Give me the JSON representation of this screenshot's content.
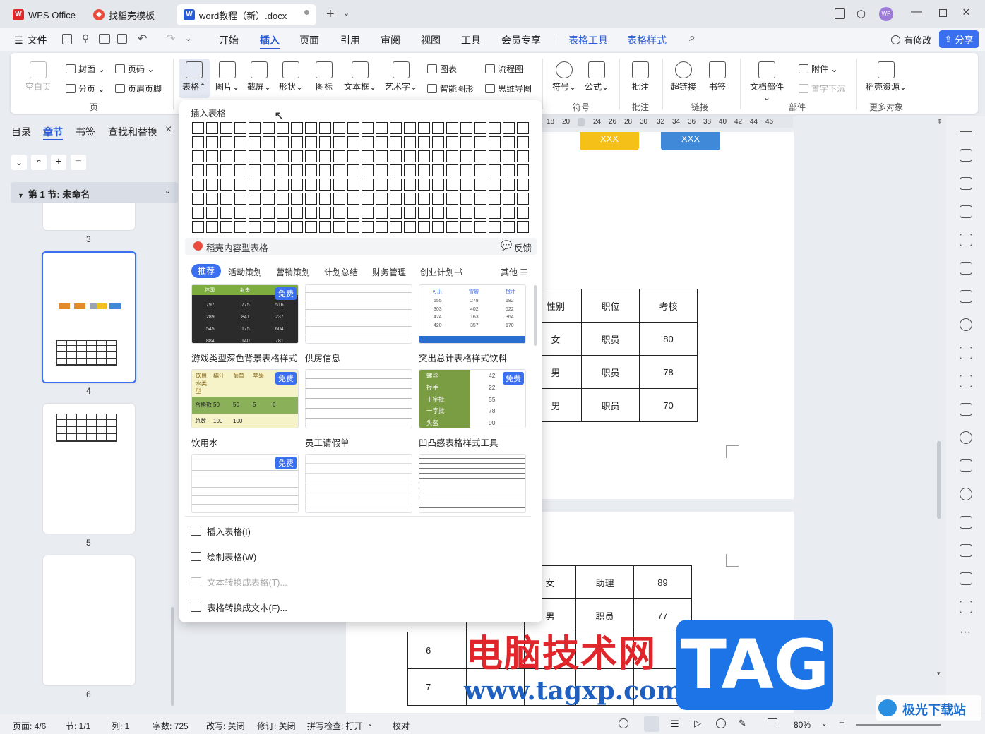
{
  "window": {
    "tabs": [
      {
        "label": "WPS Office"
      },
      {
        "label": "找稻壳模板"
      },
      {
        "label": "word教程（新）.docx"
      }
    ]
  },
  "menubar": {
    "file": "文件",
    "items": [
      "开始",
      "插入",
      "页面",
      "引用",
      "审阅",
      "视图",
      "工具",
      "会员专享",
      "表格工具",
      "表格样式"
    ],
    "has_changes": "有修改",
    "share": "分享"
  },
  "ribbon": {
    "blank_page": "空白页",
    "cover": "封面",
    "page_number": "页码",
    "section_break": "分页",
    "header_footer": "页眉页脚",
    "group_page": "页",
    "table": "表格",
    "picture": "图片",
    "screenshot": "截屏",
    "shape": "形状",
    "icon": "图标",
    "textbox": "文本框",
    "wordart": "艺术字",
    "chart": "图表",
    "smart_graphic": "智能图形",
    "flowchart": "流程图",
    "mindmap": "思维导图",
    "symbol": "符号",
    "formula": "公式",
    "group_symbol": "符号",
    "comment": "批注",
    "group_comment": "批注",
    "hyperlink": "超链接",
    "bookmark": "书签",
    "group_link": "链接",
    "attachment": "附件",
    "doc_parts": "文档部件",
    "drop_cap": "首字下沉",
    "group_parts": "部件",
    "docer_resources": "稻壳资源",
    "group_more": "更多对象"
  },
  "leftpanel": {
    "tabs": [
      "目录",
      "章节",
      "书签",
      "查找和替换"
    ],
    "section_title": "第 1 节: 未命名",
    "page_numbers": [
      "3",
      "4",
      "5",
      "6"
    ]
  },
  "ruler": {
    "ticks": [
      "18",
      "20",
      "24",
      "26",
      "28",
      "30",
      "32",
      "34",
      "36",
      "38",
      "40",
      "42",
      "44",
      "46"
    ]
  },
  "document": {
    "shape_labels": [
      "XXX",
      "XXX"
    ],
    "table1": [
      [
        "性别",
        "职位",
        "考核"
      ],
      [
        "女",
        "职员",
        "80"
      ],
      [
        "男",
        "职员",
        "78"
      ],
      [
        "男",
        "职员",
        "70"
      ]
    ],
    "table2": [
      [
        "女",
        "助理",
        "89"
      ],
      [
        "男",
        "职员",
        "77"
      ]
    ],
    "table2_row_ids": [
      "6",
      "7"
    ]
  },
  "dropdown": {
    "title": "插入表格",
    "docer_tables": "稻壳内容型表格",
    "feedback": "反馈",
    "categories": [
      "推荐",
      "活动策划",
      "营销策划",
      "计划总结",
      "财务管理",
      "创业计划书"
    ],
    "other": "其他",
    "free_badge": "免费",
    "cards": [
      {
        "label": "游戏类型深色背景表格样式",
        "free": true
      },
      {
        "label": "供房信息",
        "free": false
      },
      {
        "label": "突出总计表格样式饮料",
        "free": false
      },
      {
        "label": "饮用水",
        "free": true
      },
      {
        "label": "员工请假单",
        "free": false
      },
      {
        "label": "凹凸感表格样式工具",
        "free": true
      },
      {
        "label": "",
        "free": true
      },
      {
        "label": "",
        "free": false
      },
      {
        "label": "",
        "free": false
      }
    ],
    "card_texts": {
      "c1_headers": [
        "体国",
        "射击",
        "战术"
      ],
      "c1_rows": [
        [
          "797",
          "775",
          "516"
        ],
        [
          "289",
          "841",
          "237"
        ],
        [
          "545",
          "175",
          "604"
        ],
        [
          "884",
          "140",
          "781"
        ]
      ],
      "c3_headers": [
        "可乐",
        "雪碧",
        "橙汁"
      ],
      "c3_rows": [
        [
          "555",
          "278",
          "182"
        ],
        [
          "303",
          "402",
          "522"
        ],
        [
          "424",
          "163",
          "364"
        ],
        [
          "420",
          "357",
          "170"
        ],
        [
          "2494",
          "1878",
          "1860"
        ]
      ],
      "c4_headers": [
        "饮用水类型",
        "橘汁",
        "葡萄",
        "苹果"
      ],
      "c4_row1": [
        "合格数",
        "50",
        "50",
        "5",
        "6"
      ],
      "c4_row2": [
        "总数",
        "100",
        "100"
      ],
      "c6_rows": [
        [
          "螺丝",
          "42"
        ],
        [
          "扳手",
          "22"
        ],
        [
          "十字批",
          "55"
        ],
        [
          "一字批",
          "78"
        ],
        [
          "头盔",
          "90"
        ]
      ]
    },
    "actions": [
      {
        "label": "插入表格(I)",
        "enabled": true
      },
      {
        "label": "绘制表格(W)",
        "enabled": true
      },
      {
        "label": "文本转换成表格(T)...",
        "enabled": false
      },
      {
        "label": "表格转换成文本(F)...",
        "enabled": true
      }
    ]
  },
  "statusbar": {
    "page": "页面: 4/6",
    "section": "节: 1/1",
    "column": "列: 1",
    "word_count": "字数: 725",
    "revise": "改写: 关闭",
    "track": "修订: 关闭",
    "spell": "拼写检查: 打开",
    "proof": "校对",
    "zoom": "80%"
  },
  "watermark": {
    "cn": "电脑技术网",
    "url": "www.tagxp.com",
    "tag": "TAG",
    "site": "极光下载站"
  },
  "colors": {
    "accent": "#3a6ff0",
    "wps_red": "#e0262b",
    "word_blue": "#2a5bd7"
  }
}
